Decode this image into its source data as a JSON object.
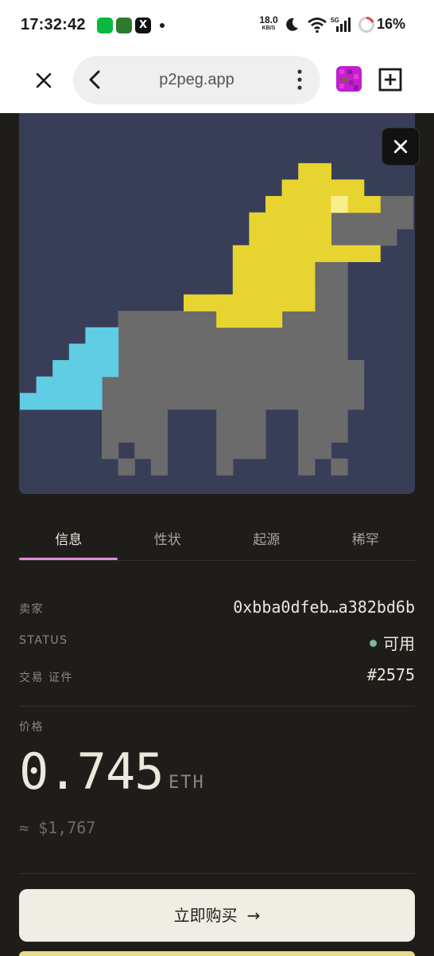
{
  "status_bar": {
    "time": "17:32:42",
    "app_icons": [
      "wechat-icon",
      "game-app-icon",
      "x-app-icon"
    ],
    "net_speed_value": "18.0",
    "net_speed_unit": "KB/S",
    "network": "5G",
    "battery_percent": "16%"
  },
  "browser": {
    "url": "p2peg.app"
  },
  "artwork": {
    "subject": "pixel-horse",
    "colors": {
      "background": "#383e58",
      "body": "#6b6b6b",
      "mane": "#e8d431",
      "eye": "#f7ef8a",
      "tail": "#5fcde4"
    }
  },
  "tabs": [
    {
      "label": "信息",
      "active": true
    },
    {
      "label": "性状",
      "active": false
    },
    {
      "label": "起源",
      "active": false
    },
    {
      "label": "稀罕",
      "active": false
    }
  ],
  "details": {
    "seller_label": "卖家",
    "seller_value": "0xbba0dfeb…a382bd6b",
    "status_label": "STATUS",
    "status_value": "可用",
    "status_color": "#7fb89a",
    "cert_label": "交易 证件",
    "cert_value": "#2575"
  },
  "price": {
    "label": "价格",
    "amount": "0.745",
    "unit": "ETH",
    "usd": "≈ $1,767"
  },
  "actions": {
    "buy_label": "立即购买",
    "buy_arrow": "→"
  },
  "colors": {
    "accent_underline": "#e58ad9",
    "page_background": "#1f1d1a",
    "button_background": "#f0ede4"
  }
}
